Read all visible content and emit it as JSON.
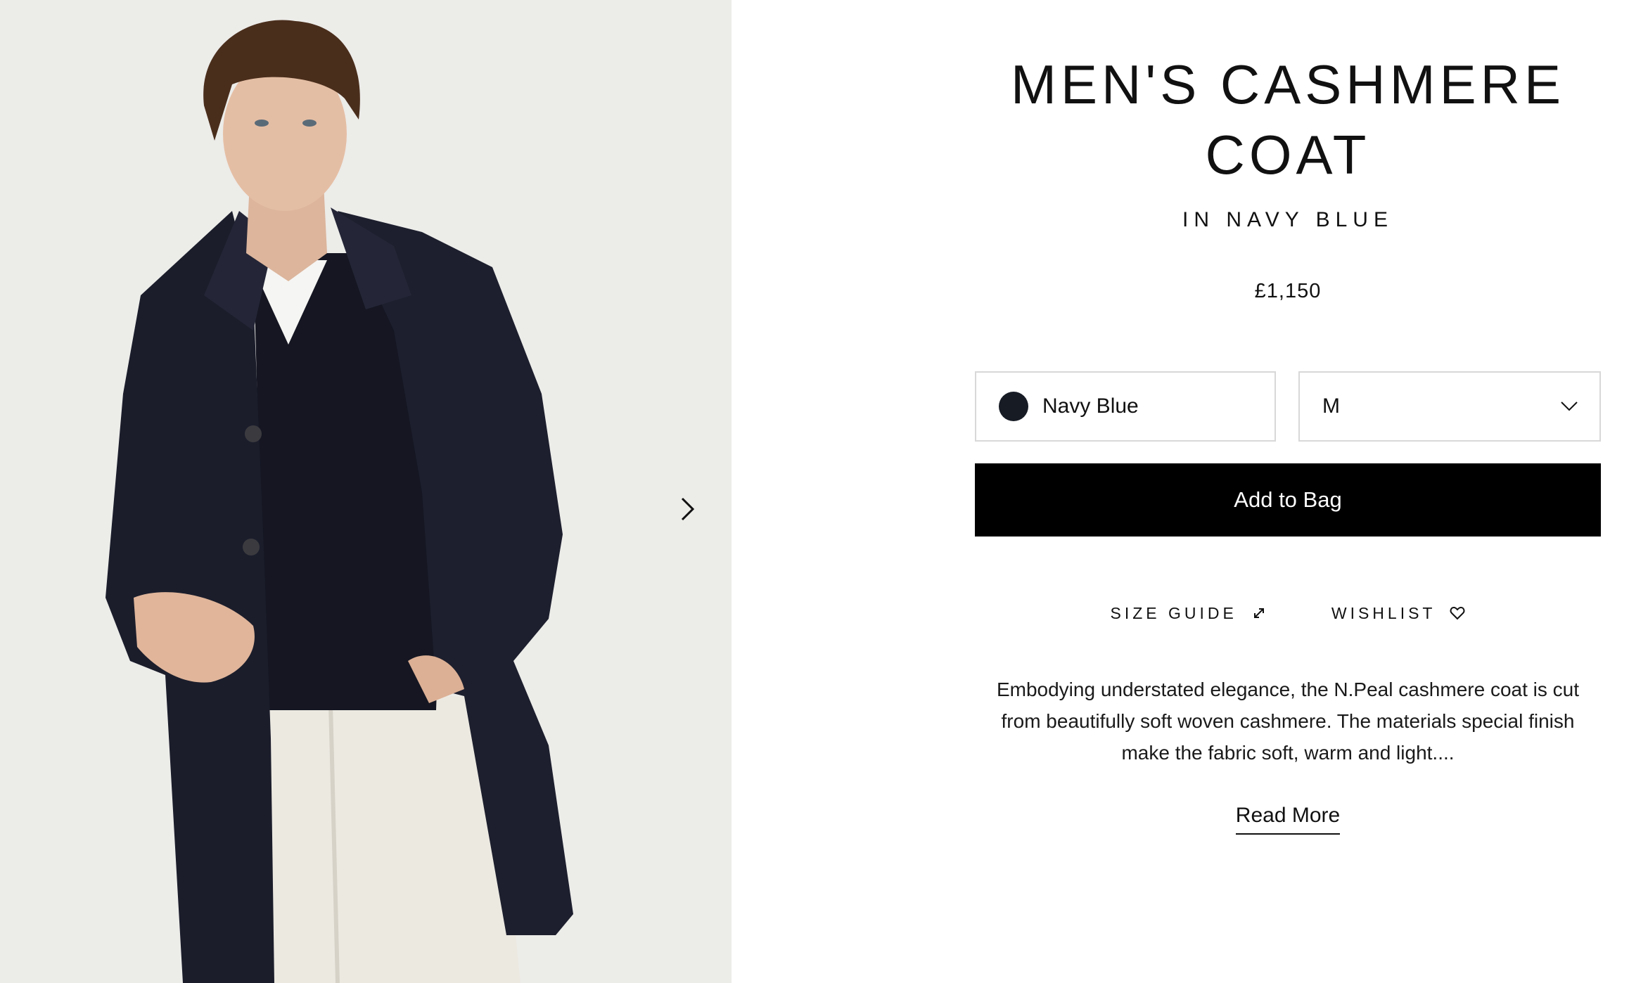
{
  "product": {
    "title_line1": "MEN'S CASHMERE",
    "title_line2": "COAT",
    "subtitle": "IN NAVY BLUE",
    "price": "£1,150"
  },
  "options": {
    "color_label": "Navy Blue",
    "color_swatch": "#161b24",
    "size_label": "M"
  },
  "actions": {
    "add_to_bag": "Add to Bag",
    "size_guide": "SIZE GUIDE",
    "wishlist": "WISHLIST",
    "read_more": "Read More"
  },
  "description": "Embodying understated elegance, the N.Peal cashmere coat is cut from beautifully soft woven cashmere. The materials special finish make the fabric soft, warm and light....",
  "icons": {
    "gallery_next": "chevron-right-icon",
    "size_dropdown": "chevron-down-icon",
    "size_guide": "resize-arrows-icon",
    "wishlist": "heart-icon"
  },
  "colors": {
    "button_bg": "#000000",
    "border": "#d8d8d8",
    "gallery_bg": "#ebebe9",
    "coat": "#1b1d2b"
  }
}
